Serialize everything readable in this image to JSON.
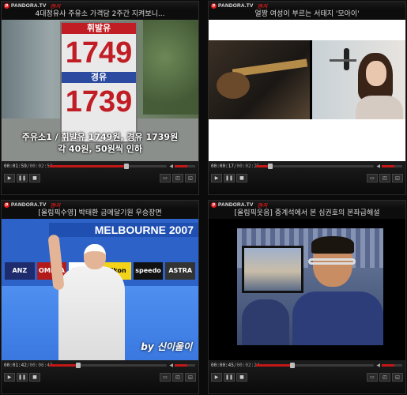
{
  "brand": {
    "name": "PANDORA.TV",
    "tag": "관/지"
  },
  "players": [
    {
      "caption": "4대정유사 주유소 가격담 2주간 지켜보니...",
      "overlay_line1": "주유소1 / 휘발유 1749원, 경유 1739원",
      "overlay_line2": "각 40원, 50원씩 인하",
      "sign_gas_label": "휘발유",
      "sign_gas_price": "1749",
      "sign_diesel_label": "경유",
      "sign_diesel_price": "1739",
      "time_current": "00:01:59",
      "time_total": "00:02:52",
      "progress": 0.66,
      "volume": 0.6
    },
    {
      "caption": "얼짱 여성이 부르는 서태지 '모아이'",
      "time_current": "00:00:17",
      "time_total": "00:02:25",
      "progress": 0.12,
      "volume": 0.6
    },
    {
      "caption": "[올림픽수영] 박태환 금메달기원 우승장면",
      "banner": "MELBOURNE 2007",
      "sponsors": [
        "ANZ",
        "OMEGA",
        "Yakult",
        "Nikon",
        "speedo",
        "ASTRA"
      ],
      "watermark": "by 신이울이",
      "time_current": "00:01:42",
      "time_total": "00:06:47",
      "progress": 0.25,
      "volume": 0.6
    },
    {
      "caption": "[올림픽웃음] 중계석에서 본 심권호의 본좌급해설",
      "time_current": "00:00:45",
      "time_total": "00:02:24",
      "progress": 0.31,
      "volume": 0.6
    }
  ]
}
